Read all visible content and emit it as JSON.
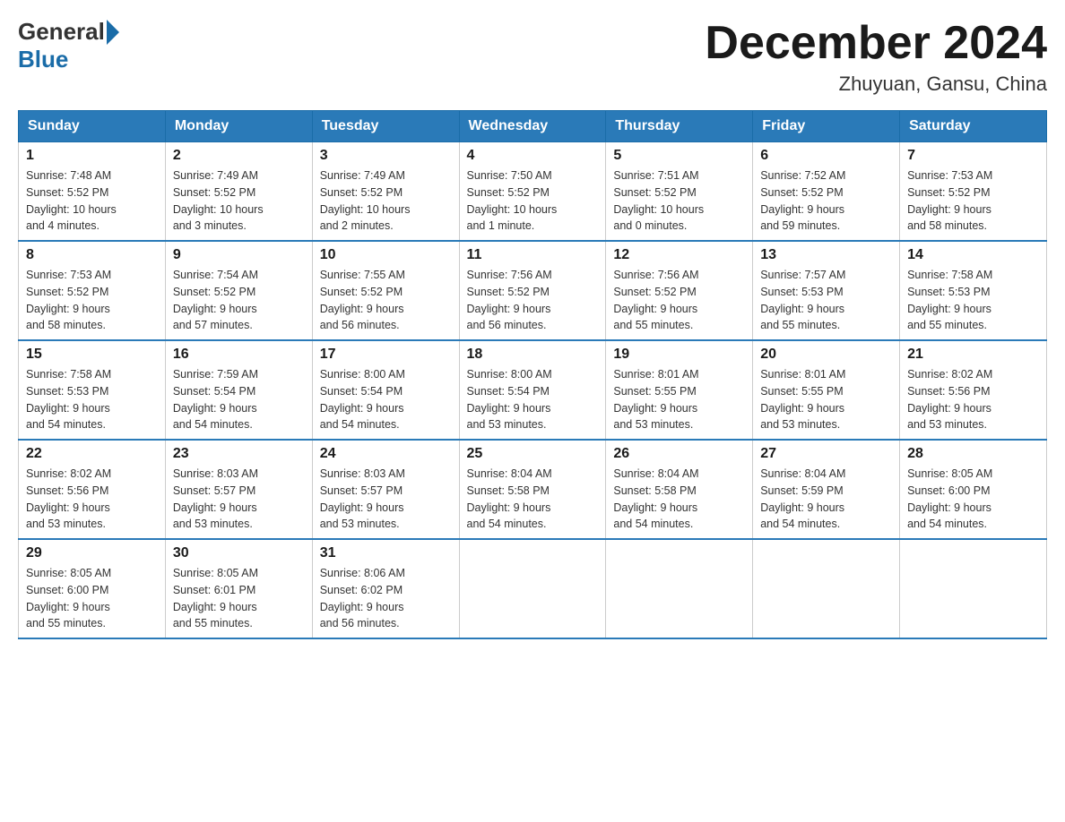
{
  "logo": {
    "general": "General",
    "blue": "Blue"
  },
  "title": {
    "month_year": "December 2024",
    "location": "Zhuyuan, Gansu, China"
  },
  "weekdays": [
    "Sunday",
    "Monday",
    "Tuesday",
    "Wednesday",
    "Thursday",
    "Friday",
    "Saturday"
  ],
  "weeks": [
    [
      {
        "day": "1",
        "sunrise": "7:48 AM",
        "sunset": "5:52 PM",
        "daylight": "10 hours and 4 minutes."
      },
      {
        "day": "2",
        "sunrise": "7:49 AM",
        "sunset": "5:52 PM",
        "daylight": "10 hours and 3 minutes."
      },
      {
        "day": "3",
        "sunrise": "7:49 AM",
        "sunset": "5:52 PM",
        "daylight": "10 hours and 2 minutes."
      },
      {
        "day": "4",
        "sunrise": "7:50 AM",
        "sunset": "5:52 PM",
        "daylight": "10 hours and 1 minute."
      },
      {
        "day": "5",
        "sunrise": "7:51 AM",
        "sunset": "5:52 PM",
        "daylight": "10 hours and 0 minutes."
      },
      {
        "day": "6",
        "sunrise": "7:52 AM",
        "sunset": "5:52 PM",
        "daylight": "9 hours and 59 minutes."
      },
      {
        "day": "7",
        "sunrise": "7:53 AM",
        "sunset": "5:52 PM",
        "daylight": "9 hours and 58 minutes."
      }
    ],
    [
      {
        "day": "8",
        "sunrise": "7:53 AM",
        "sunset": "5:52 PM",
        "daylight": "9 hours and 58 minutes."
      },
      {
        "day": "9",
        "sunrise": "7:54 AM",
        "sunset": "5:52 PM",
        "daylight": "9 hours and 57 minutes."
      },
      {
        "day": "10",
        "sunrise": "7:55 AM",
        "sunset": "5:52 PM",
        "daylight": "9 hours and 56 minutes."
      },
      {
        "day": "11",
        "sunrise": "7:56 AM",
        "sunset": "5:52 PM",
        "daylight": "9 hours and 56 minutes."
      },
      {
        "day": "12",
        "sunrise": "7:56 AM",
        "sunset": "5:52 PM",
        "daylight": "9 hours and 55 minutes."
      },
      {
        "day": "13",
        "sunrise": "7:57 AM",
        "sunset": "5:53 PM",
        "daylight": "9 hours and 55 minutes."
      },
      {
        "day": "14",
        "sunrise": "7:58 AM",
        "sunset": "5:53 PM",
        "daylight": "9 hours and 55 minutes."
      }
    ],
    [
      {
        "day": "15",
        "sunrise": "7:58 AM",
        "sunset": "5:53 PM",
        "daylight": "9 hours and 54 minutes."
      },
      {
        "day": "16",
        "sunrise": "7:59 AM",
        "sunset": "5:54 PM",
        "daylight": "9 hours and 54 minutes."
      },
      {
        "day": "17",
        "sunrise": "8:00 AM",
        "sunset": "5:54 PM",
        "daylight": "9 hours and 54 minutes."
      },
      {
        "day": "18",
        "sunrise": "8:00 AM",
        "sunset": "5:54 PM",
        "daylight": "9 hours and 53 minutes."
      },
      {
        "day": "19",
        "sunrise": "8:01 AM",
        "sunset": "5:55 PM",
        "daylight": "9 hours and 53 minutes."
      },
      {
        "day": "20",
        "sunrise": "8:01 AM",
        "sunset": "5:55 PM",
        "daylight": "9 hours and 53 minutes."
      },
      {
        "day": "21",
        "sunrise": "8:02 AM",
        "sunset": "5:56 PM",
        "daylight": "9 hours and 53 minutes."
      }
    ],
    [
      {
        "day": "22",
        "sunrise": "8:02 AM",
        "sunset": "5:56 PM",
        "daylight": "9 hours and 53 minutes."
      },
      {
        "day": "23",
        "sunrise": "8:03 AM",
        "sunset": "5:57 PM",
        "daylight": "9 hours and 53 minutes."
      },
      {
        "day": "24",
        "sunrise": "8:03 AM",
        "sunset": "5:57 PM",
        "daylight": "9 hours and 53 minutes."
      },
      {
        "day": "25",
        "sunrise": "8:04 AM",
        "sunset": "5:58 PM",
        "daylight": "9 hours and 54 minutes."
      },
      {
        "day": "26",
        "sunrise": "8:04 AM",
        "sunset": "5:58 PM",
        "daylight": "9 hours and 54 minutes."
      },
      {
        "day": "27",
        "sunrise": "8:04 AM",
        "sunset": "5:59 PM",
        "daylight": "9 hours and 54 minutes."
      },
      {
        "day": "28",
        "sunrise": "8:05 AM",
        "sunset": "6:00 PM",
        "daylight": "9 hours and 54 minutes."
      }
    ],
    [
      {
        "day": "29",
        "sunrise": "8:05 AM",
        "sunset": "6:00 PM",
        "daylight": "9 hours and 55 minutes."
      },
      {
        "day": "30",
        "sunrise": "8:05 AM",
        "sunset": "6:01 PM",
        "daylight": "9 hours and 55 minutes."
      },
      {
        "day": "31",
        "sunrise": "8:06 AM",
        "sunset": "6:02 PM",
        "daylight": "9 hours and 56 minutes."
      },
      null,
      null,
      null,
      null
    ]
  ],
  "labels": {
    "sunrise": "Sunrise:",
    "sunset": "Sunset:",
    "daylight": "Daylight:"
  }
}
